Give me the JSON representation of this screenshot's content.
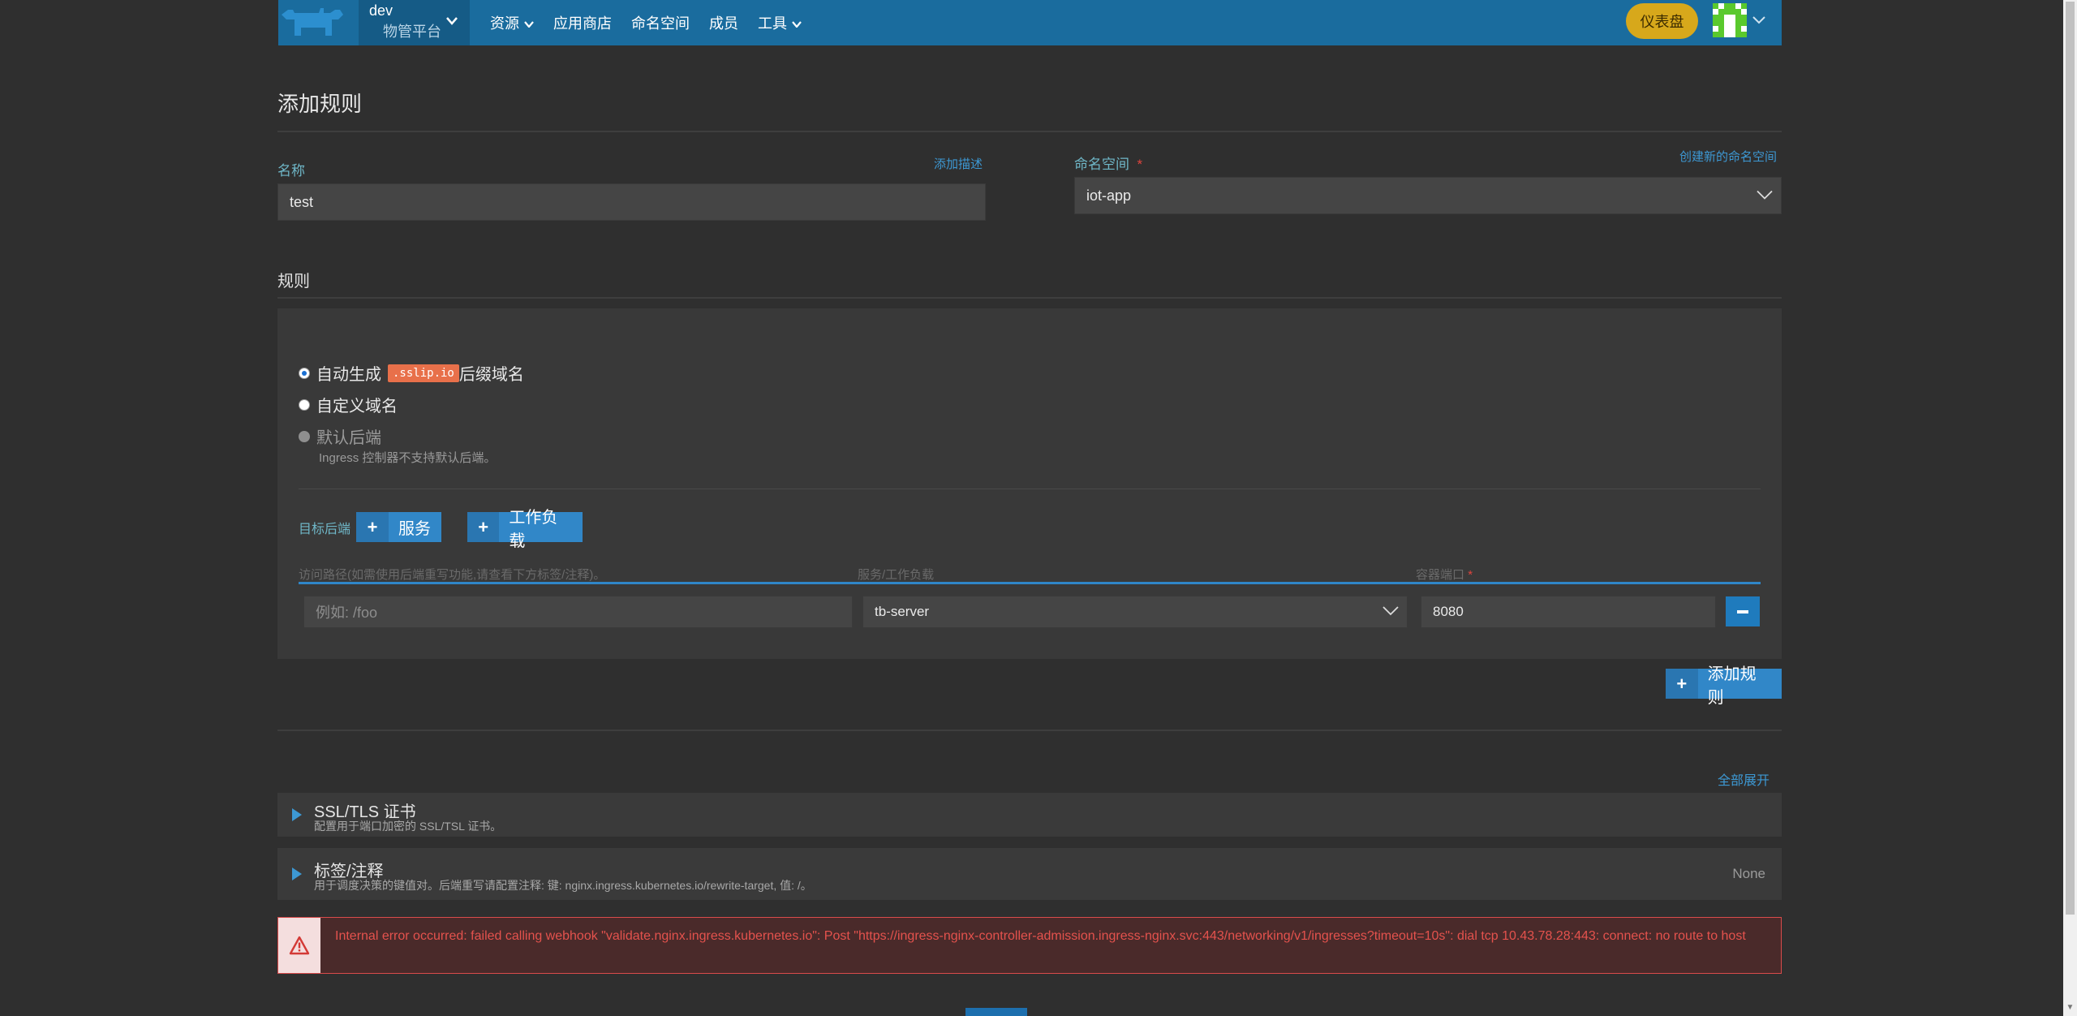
{
  "navbar": {
    "cluster_name": "dev",
    "project_name": "物管平台",
    "items": [
      {
        "label": "资源",
        "has_dropdown": true
      },
      {
        "label": "应用商店",
        "has_dropdown": false
      },
      {
        "label": "命名空间",
        "has_dropdown": false
      },
      {
        "label": "成员",
        "has_dropdown": false
      },
      {
        "label": "工具",
        "has_dropdown": true
      }
    ],
    "dashboard_label": "仪表盘"
  },
  "page": {
    "title": "添加规则"
  },
  "form": {
    "name_label": "名称",
    "add_description_link": "添加描述",
    "name_value": "test",
    "namespace_label": "命名空间",
    "namespace_required": "*",
    "create_namespace_link": "创建新的命名空间",
    "namespace_value": "iot-app"
  },
  "rules": {
    "section_title": "规则",
    "radio_auto_prefix": "自动生成",
    "radio_auto_tag": ".sslip.io",
    "radio_auto_suffix": "后缀域名",
    "radio_custom": "自定义域名",
    "radio_default": "默认后端",
    "default_hint": "Ingress 控制器不支持默认后端。",
    "target_label": "目标后端",
    "service_button": "服务",
    "workload_button": "工作负载",
    "col_path": "访问路径(如需使用后端重写功能,请查看下方标签/注释)。",
    "col_target": "服务/工作负载",
    "col_port": "容器端口",
    "col_port_required": "*",
    "path_placeholder": "例如: /foo",
    "target_value": "tb-server",
    "port_value": "8080",
    "add_rule_button": "添加规则"
  },
  "sections": {
    "expand_all": "全部展开",
    "ssl_title": "SSL/TLS 证书",
    "ssl_sub": "配置用于端口加密的 SSL/TSL 证书。",
    "labels_title": "标签/注释",
    "labels_sub": "用于调度决策的键值对。后端重写请配置注释: 键: nginx.ingress.kubernetes.io/rewrite-target, 值: /。",
    "labels_value": "None"
  },
  "error": {
    "message": "Internal error occurred: failed calling webhook \"validate.nginx.ingress.kubernetes.io\": Post \"https://ingress-nginx-controller-admission.ingress-nginx.svc:443/networking/v1/ingresses?timeout=10s\": dial tcp 10.43.78.28:443: connect: no route to host"
  },
  "colors": {
    "navbar": "#1a6c9e",
    "accent": "#3187c8",
    "dashboard": "#d7a81b",
    "error": "#e4524d",
    "tag": "#e8704a"
  },
  "icons": {
    "logo": "rancher-logo-icon",
    "chevron": "chevron-down-icon",
    "plus": "plus-icon",
    "minus": "minus-icon",
    "expand": "caret-right-icon",
    "warning": "warning-triangle-icon"
  }
}
